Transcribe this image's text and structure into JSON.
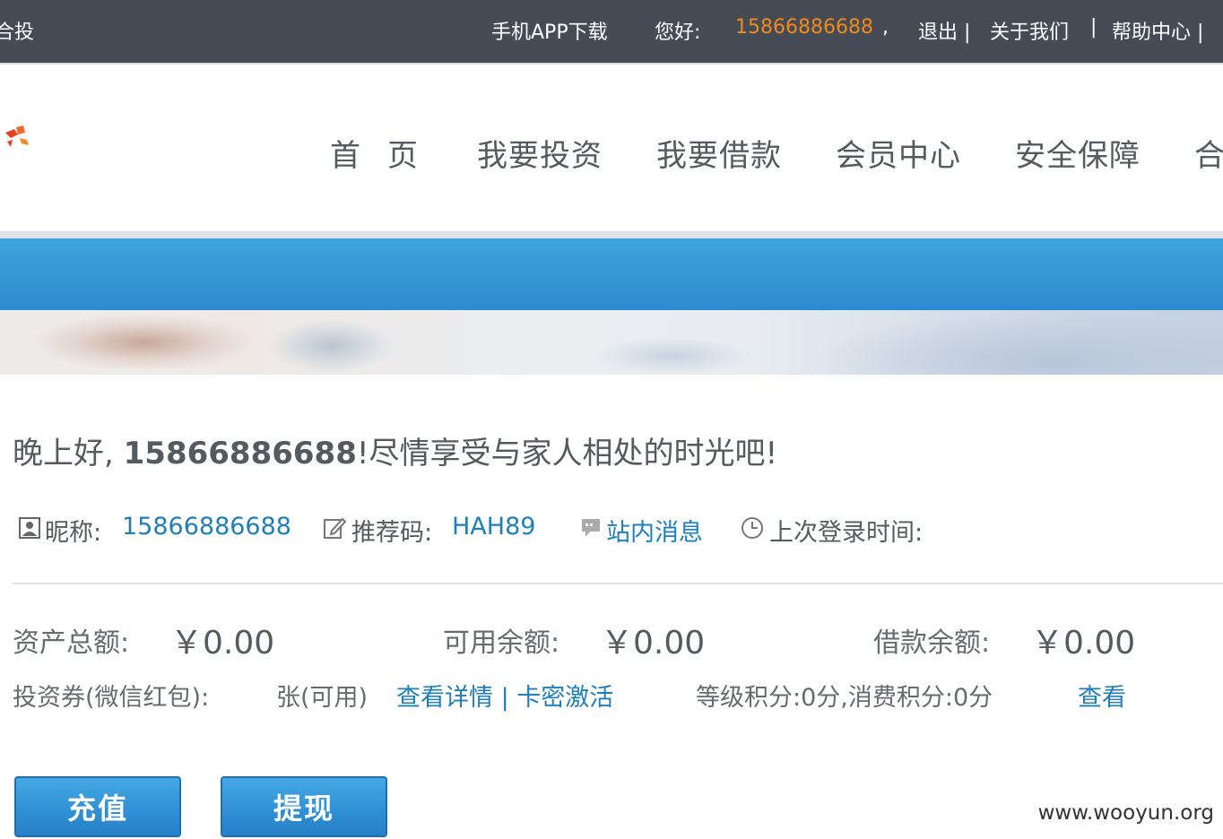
{
  "topbar": {
    "brand_fragment": "合投",
    "app_download": "手机APP下载",
    "hello_label": "您好:",
    "username": "15866886688",
    "comma": ",",
    "logout": "退出 |",
    "about": "关于我们",
    "sep": "|",
    "help": "帮助中心 |"
  },
  "nav": {
    "items": [
      "首页",
      "我要投资",
      "我要借款",
      "会员中心",
      "安全保障",
      "合"
    ]
  },
  "greeting": {
    "prefix": "晚上好, ",
    "user": "15866886688",
    "suffix": "!尽情享受与家人相处的时光吧!"
  },
  "info": {
    "nickname_label": "昵称:",
    "nickname_value": "15866886688",
    "referral_label": "推荐码:",
    "referral_value": "HAH89",
    "messages": "站内消息",
    "last_login_label": "上次登录时间:"
  },
  "assets": {
    "total_label": "资产总额:",
    "total_value": "￥0.00",
    "available_label": "可用余额:",
    "available_value": "￥0.00",
    "loan_label": "借款余额:",
    "loan_value": "￥0.00"
  },
  "vouchers": {
    "label": "投资券(微信红包):",
    "count": "张(可用)",
    "links": "查看详情 | 卡密激活",
    "points": "等级积分:0分,消费积分:0分",
    "view": "查看"
  },
  "buttons": {
    "recharge": "充值",
    "withdraw": "提现"
  },
  "watermark": "www.wooyun.org",
  "colors": {
    "topbar_bg": "#464c56",
    "accent_orange": "#f08a1c",
    "link_blue": "#1e7fbd",
    "banner_blue": "#3399d6"
  }
}
